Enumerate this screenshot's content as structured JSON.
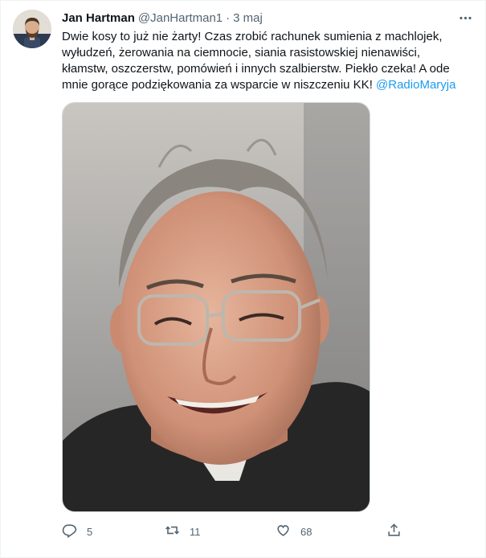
{
  "tweet": {
    "author_name": "Jan Hartman",
    "handle": "@JanHartman1",
    "separator": "·",
    "date": "3 maj",
    "text_lines": [
      "Dwie kosy to już nie żarty! Czas zrobić rachunek sumienia z machlojek,",
      "wyłudzeń, żerowania na ciemnocie, siania rasistowskiej nienawiści,",
      "kłamstw, oszczerstw, pomówień i innych szalbierstw. Piekło czeka! A ode",
      "mnie gorące podziękowania za wsparcie w niszczeniu KK! "
    ],
    "mention": "@RadioMaryja",
    "media_description": "photo",
    "actions": {
      "reply_count": "5",
      "retweet_count": "11",
      "like_count": "68",
      "share_label": ""
    }
  },
  "icons": {
    "more": "more-dots-icon",
    "reply": "reply-icon",
    "retweet": "retweet-icon",
    "like": "heart-icon",
    "share": "share-icon"
  },
  "colors": {
    "text": "#0f1419",
    "secondary": "#536471",
    "link": "#1d9bf0",
    "border": "#eff3f4"
  }
}
